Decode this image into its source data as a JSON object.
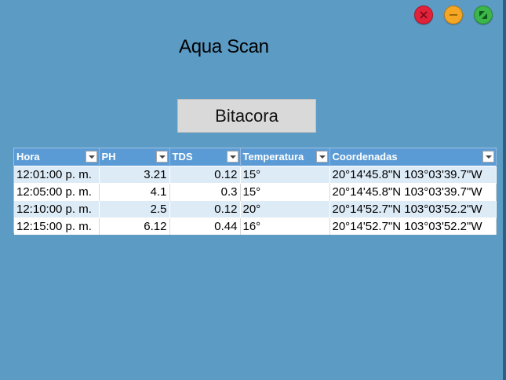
{
  "app": {
    "title": "Aqua Scan",
    "button_label": "Bitacora"
  },
  "window_controls": {
    "close_icon": "close-icon",
    "minimize_icon": "minimize-icon",
    "maximize_icon": "maximize-icon",
    "colors": {
      "close": "#e2223a",
      "minimize": "#f5a623",
      "maximize": "#3cb54a"
    }
  },
  "table": {
    "columns": [
      "Hora",
      "PH",
      "TDS",
      "Temperatura",
      "Coordenadas"
    ],
    "rows": [
      [
        "12:01:00 p. m.",
        "3.21",
        "0.12",
        "15°",
        "20°14'45.8\"N 103°03'39.7\"W"
      ],
      [
        "12:05:00 p. m.",
        "4.1",
        "0.3",
        "15°",
        "20°14'45.8\"N 103°03'39.7\"W"
      ],
      [
        "12:10:00 p. m.",
        "2.5",
        "0.12",
        "20°",
        "20°14'52.7\"N 103°03'52.2\"W"
      ],
      [
        "12:15:00 p. m.",
        "6.12",
        "0.44",
        "16°",
        "20°14'52.7\"N 103°03'52.2\"W"
      ]
    ],
    "header_color": "#5b9bd5",
    "band_color": "#ddebf7"
  },
  "background_color": "#5b9bc4"
}
